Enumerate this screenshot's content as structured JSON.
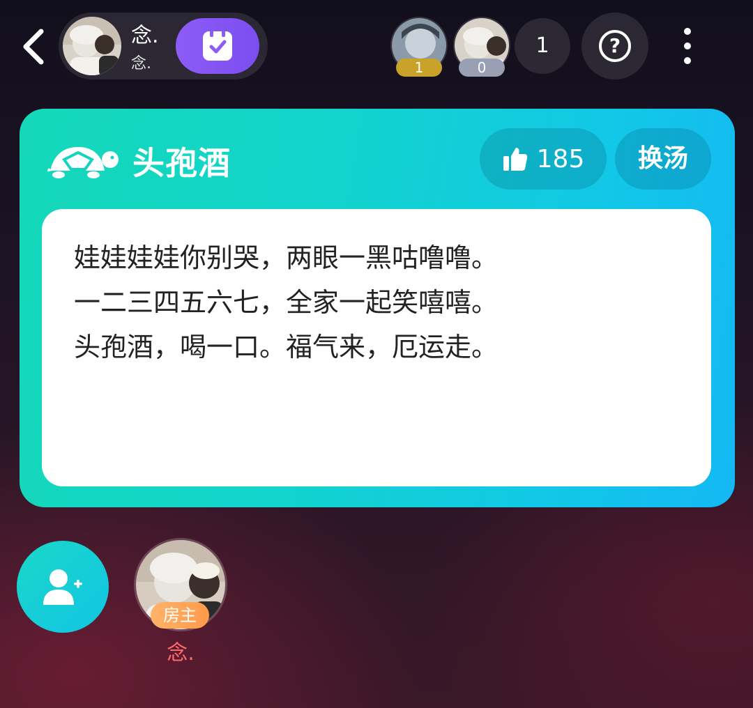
{
  "header": {
    "host_name": "念.",
    "host_sub": "念.",
    "checkin_icon": "calendar-check-icon",
    "audience": [
      {
        "badge": "1",
        "badge_color": "#c9a22a"
      },
      {
        "badge": "0",
        "badge_color": "#9aa0b4"
      }
    ],
    "audience_count": "1",
    "help_label": "?"
  },
  "game": {
    "title": "头孢酒",
    "icon": "turtle-icon",
    "like_count": "185",
    "swap_label": "换汤",
    "lyrics": [
      "娃娃娃娃你别哭，两眼一黑咕噜噜。",
      "一二三四五六七，全家一起笑嘻嘻。",
      "头孢酒，喝一口。福气来，厄运走。"
    ],
    "accent_color": "#14d4cc"
  },
  "seats": {
    "owner_badge": "房主",
    "owner_name": "念.",
    "invite_icon": "add-user-icon"
  }
}
